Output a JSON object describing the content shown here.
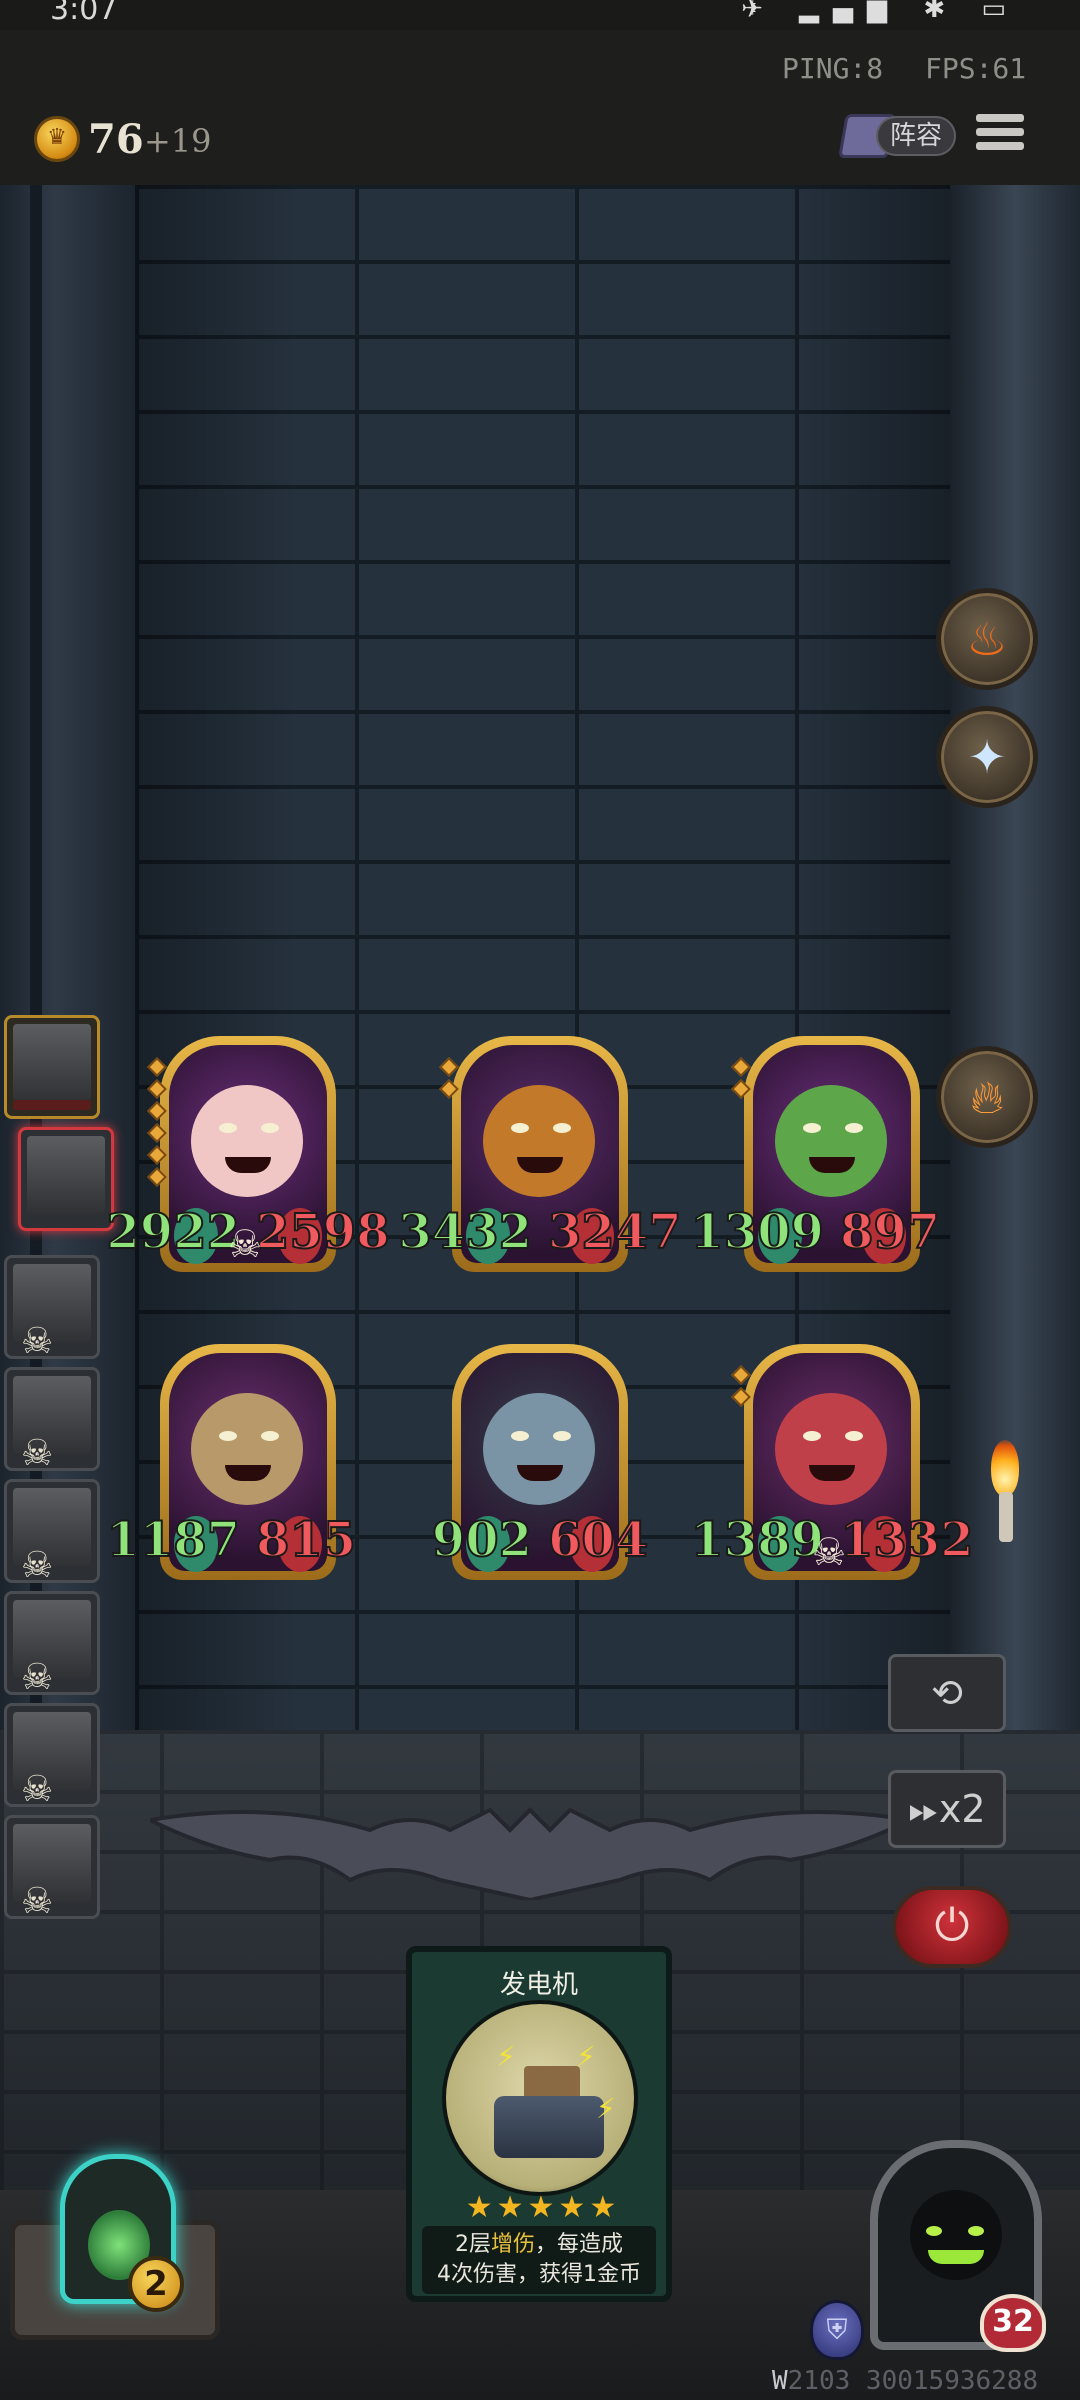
{
  "status": {
    "time": "3:07"
  },
  "hud": {
    "ping": "PING:8",
    "fps": "FPS:61",
    "gold": "76",
    "gold_income": "+19",
    "lineup_label": "阵容"
  },
  "queue": [
    {
      "name": "shadow-tree",
      "state": "active"
    },
    {
      "name": "masked-bandit",
      "state": "selected"
    },
    {
      "name": "unit-3",
      "state": "dead"
    },
    {
      "name": "unit-4",
      "state": "dead"
    },
    {
      "name": "unit-5",
      "state": "dead"
    },
    {
      "name": "unit-6",
      "state": "dead"
    },
    {
      "name": "unit-7",
      "state": "dead"
    },
    {
      "name": "unit-8",
      "state": "dead"
    }
  ],
  "board": [
    {
      "name": "pink-girl",
      "atk": "2922",
      "hp": "2598",
      "stars": 6,
      "dead": true,
      "bg": "#6b2f7a",
      "face": "#f0c7c4"
    },
    {
      "name": "pumpkin",
      "atk": "3432",
      "hp": "3247",
      "stars": 2,
      "dead": false,
      "bg": "#5a2f6a",
      "face": "#c27a2a"
    },
    {
      "name": "cactus",
      "atk": "1309",
      "hp": "897",
      "stars": 2,
      "dead": false,
      "bg": "#6a2f7a",
      "face": "#5ea64a"
    },
    {
      "name": "treant",
      "atk": "1187",
      "hp": "815",
      "stars": 0,
      "dead": false,
      "bg": "#6b3070",
      "face": "#b89a6a"
    },
    {
      "name": "beast",
      "atk": "902",
      "hp": "604",
      "stars": 0,
      "dead": false,
      "bg": "#34404a",
      "face": "#7a94a6"
    },
    {
      "name": "dragon",
      "atk": "1389",
      "hp": "1332",
      "stars": 2,
      "dead": true,
      "bg": "#6b2f6a",
      "face": "#c0404a"
    }
  ],
  "controls": {
    "speed_label": "x2"
  },
  "hand_card": {
    "title": "发电机",
    "stars": "★★★★★",
    "desc_line1_pre": "2层",
    "desc_line1_hl": "增伤",
    "desc_line1_post": "，每造成",
    "desc_line2": "4次伤害，获得1金币"
  },
  "player": {
    "deck_count": "2",
    "boss_hp": "32"
  },
  "watermark": {
    "prefix": "W",
    "id": "2103 30015936288"
  }
}
